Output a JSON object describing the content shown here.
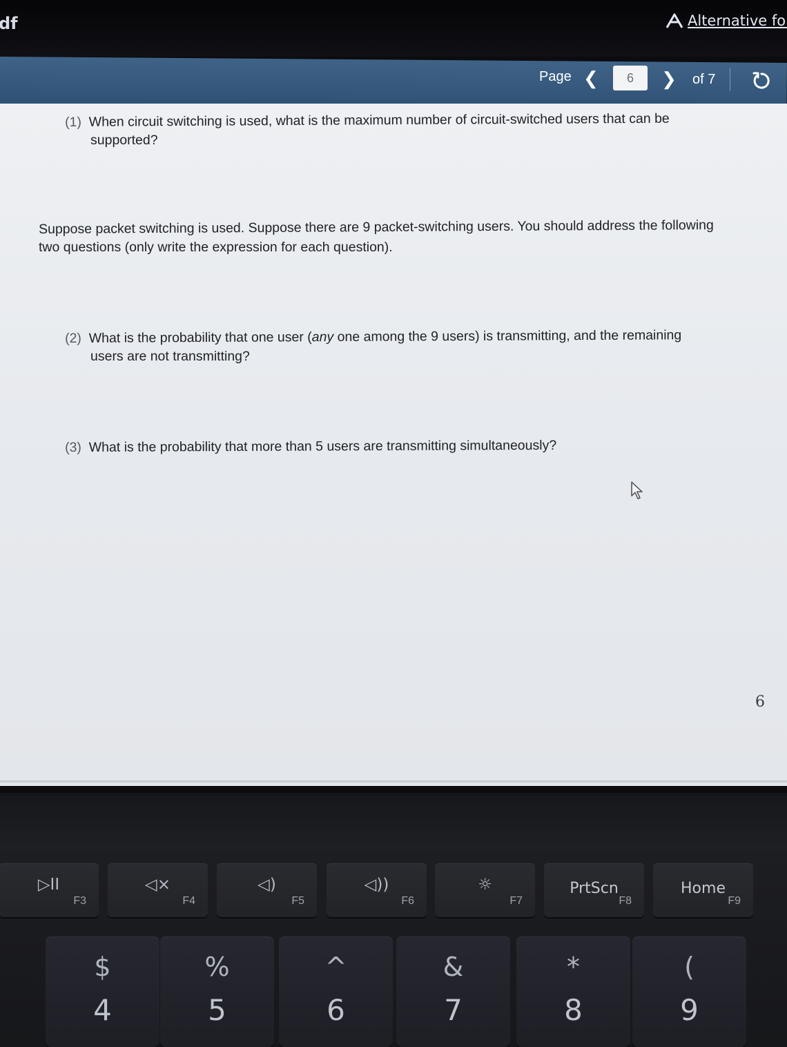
{
  "app_bar": {
    "title": "df",
    "alt_formats_label": "Alternative for"
  },
  "pager": {
    "page_label": "Page",
    "current_page": "6",
    "of_label": "of 7"
  },
  "document": {
    "q1": {
      "num": "(1)",
      "line1": "When circuit switching is used, what is the maximum number of circuit-switched users that can be",
      "line2": "supported?"
    },
    "intro": {
      "line1": "Suppose packet switching is used. Suppose there are 9 packet-switching users. You should address the following",
      "line2": "two questions (only write the expression for each question)."
    },
    "q2": {
      "num": "(2)",
      "line1_a": "What is the probability that one user (",
      "line1_em": "any",
      "line1_b": " one among the 9 users) is transmitting, and the remaining",
      "line2": "users are not transmitting?"
    },
    "q3": {
      "num": "(3)",
      "text": "What is the probability that more than 5 users are transmitting simultaneously?"
    },
    "page_number": "6"
  },
  "keyboard": {
    "function_keys": [
      {
        "symbol": "▷II",
        "fn": "F3",
        "icon": "play-pause-icon"
      },
      {
        "symbol": "◁×",
        "fn": "F4",
        "icon": "mute-icon"
      },
      {
        "symbol": "◁)",
        "fn": "F5",
        "icon": "volume-down-icon"
      },
      {
        "symbol": "◁))",
        "fn": "F6",
        "icon": "volume-up-icon"
      },
      {
        "symbol": "☼",
        "fn": "F7",
        "icon": "brightness-icon"
      },
      {
        "symbol": "PrtScn",
        "fn": "F8",
        "icon": ""
      },
      {
        "symbol": "Home",
        "fn": "F9",
        "icon": ""
      }
    ],
    "number_keys": [
      {
        "top": "$",
        "bottom": "4"
      },
      {
        "top": "%",
        "bottom": "5"
      },
      {
        "top": "^",
        "bottom": "6"
      },
      {
        "top": "&",
        "bottom": "7"
      },
      {
        "top": "*",
        "bottom": "8"
      },
      {
        "top": "(",
        "bottom": "9"
      }
    ]
  }
}
